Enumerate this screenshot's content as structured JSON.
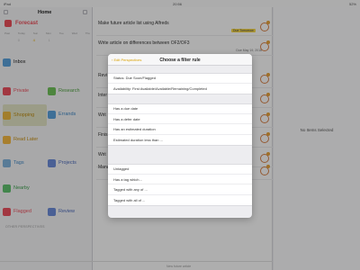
{
  "statusbar": {
    "left": "iPad",
    "time": "20:56",
    "right": "52%"
  },
  "sidebar": {
    "title": "Home",
    "forecast": {
      "label": "Forecast",
      "days": [
        "Past",
        "Today",
        "Sun",
        "Mon",
        "Tue",
        "Wed",
        "Thu"
      ],
      "nums": [
        "",
        "0",
        "4",
        "1",
        "",
        "",
        ""
      ]
    },
    "inbox": "Inbox",
    "private": "Private",
    "research": "Research",
    "shopping": "Shopping",
    "errands": "Errands",
    "read_later": "Read Later",
    "tags": "Tags",
    "projects": "Projects",
    "nearby": "Nearby",
    "flagged": "Flagged",
    "review": "Review",
    "other_perspectives": "OTHER PERSPECTIVES"
  },
  "main": {
    "tasks": [
      {
        "title": "Make future article list using Alfreds",
        "date": "",
        "badge": "Due Tomorrow"
      },
      {
        "title": "Write article on differences between OF2/OF3",
        "date": "Due May 19, 2018",
        "badge": ""
      },
      {
        "title": "Revi",
        "date": "",
        "badge": ""
      },
      {
        "title": "Inter",
        "date": "",
        "badge": ""
      },
      {
        "title": "Writ",
        "date": "",
        "badge": ""
      },
      {
        "title": "Finis",
        "date": "",
        "badge": ""
      },
      {
        "title": "Writ",
        "date": "",
        "badge": ""
      },
      {
        "title": "Mana",
        "date": "",
        "badge": ""
      }
    ],
    "bottom_label": "New future article"
  },
  "inspector": {
    "empty_text": "No Items Selected"
  },
  "popover": {
    "back_label": "Edit Perspectives",
    "title": "Choose a filter rule",
    "groups": [
      [
        "Status: Due Soon/Flagged",
        "Availability: First Available/Available/Remaining/Completed"
      ],
      [
        "Has a due date",
        "Has a defer date",
        "Has an estimated duration",
        "Estimated duration less than ..."
      ],
      [
        "Untagged",
        "Has a tag which...",
        "Tagged with any of ...",
        "Tagged with all of ..."
      ]
    ]
  },
  "colors": {
    "forecast": "#e94f5a",
    "inbox": "#5aa0d8",
    "private": "#e9505d",
    "research": "#6fbf59",
    "shopping": "#e8b540",
    "errands": "#5aa0d8",
    "read_later": "#f1b642",
    "tags": "#7fb0d8",
    "projects": "#6b8ad6",
    "nearby": "#5fbf6e",
    "flagged": "#e9505d",
    "review": "#6b8ad6",
    "accent": "#d9a100"
  }
}
